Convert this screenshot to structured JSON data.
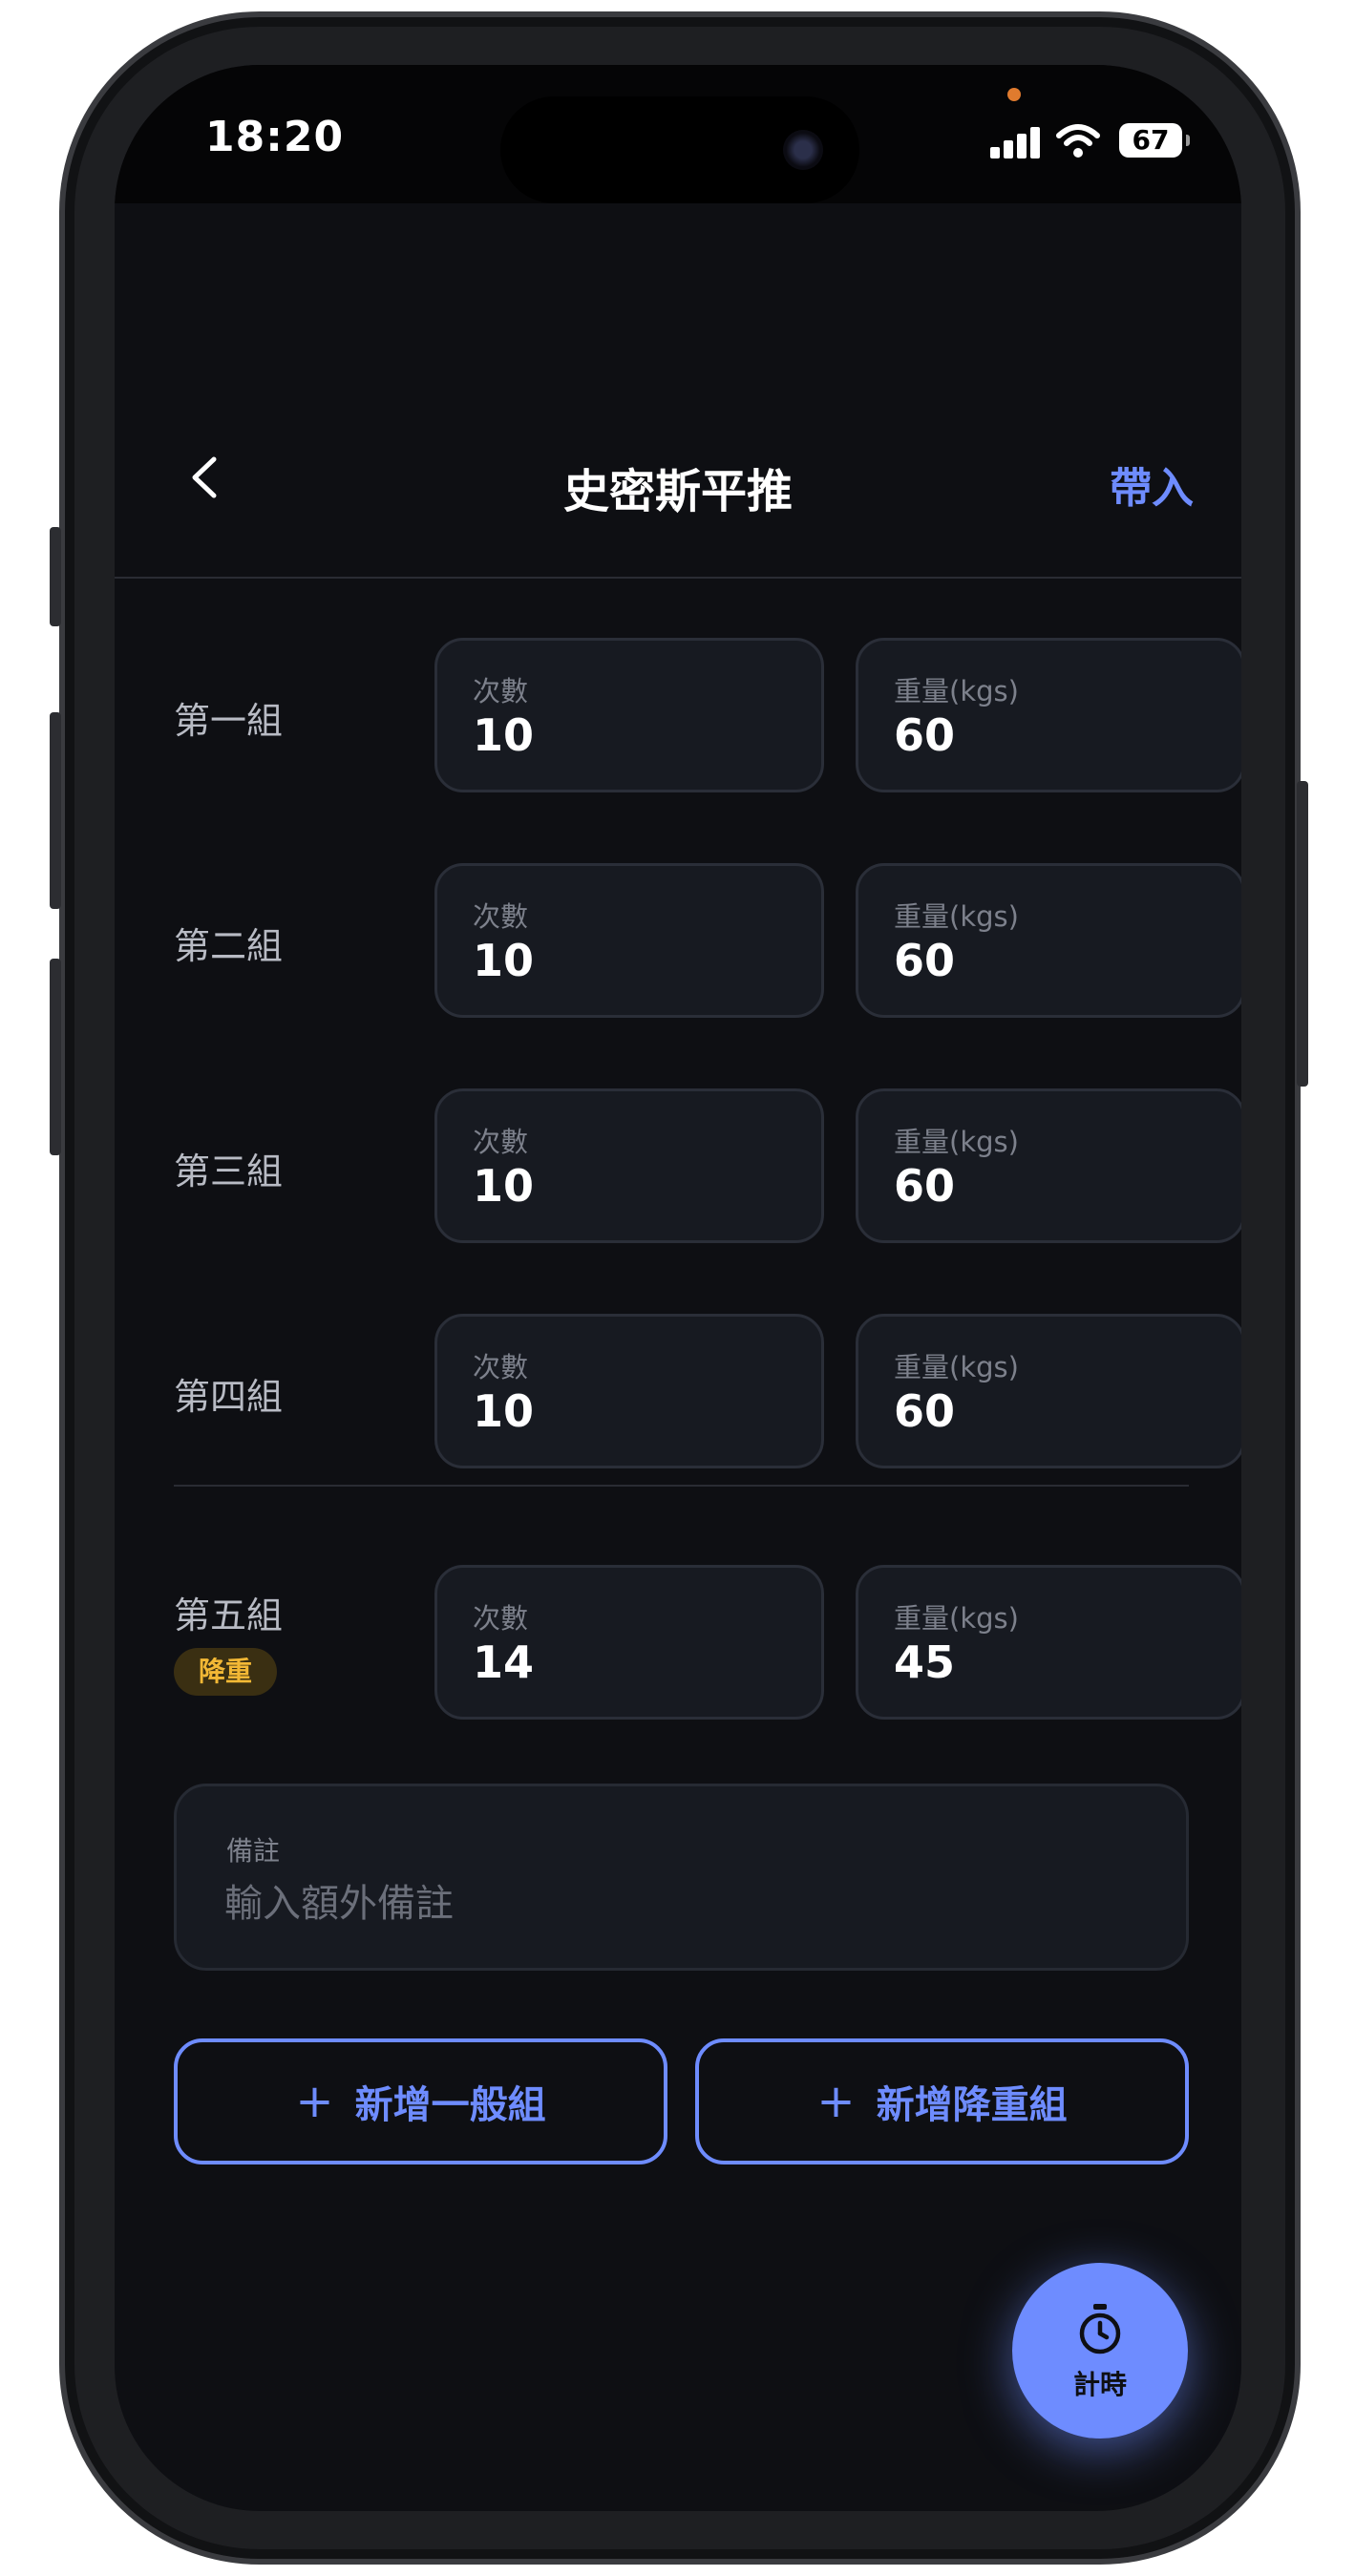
{
  "status_bar": {
    "time": "18:20",
    "battery": "67"
  },
  "header": {
    "title": "史密斯平推",
    "action_label": "帶入"
  },
  "sets": [
    {
      "label": "第一組",
      "reps_label": "次數",
      "reps": "10",
      "weight_label": "重量(kgs)",
      "weight": "60"
    },
    {
      "label": "第二組",
      "reps_label": "次數",
      "reps": "10",
      "weight_label": "重量(kgs)",
      "weight": "60"
    },
    {
      "label": "第三組",
      "reps_label": "次數",
      "reps": "10",
      "weight_label": "重量(kgs)",
      "weight": "60"
    },
    {
      "label": "第四組",
      "reps_label": "次數",
      "reps": "10",
      "weight_label": "重量(kgs)",
      "weight": "60"
    },
    {
      "label": "第五組",
      "badge": "降重",
      "reps_label": "次數",
      "reps": "14",
      "weight_label": "重量(kgs)",
      "weight": "45"
    }
  ],
  "notes": {
    "label": "備註",
    "placeholder": "輸入額外備註"
  },
  "buttons": {
    "add_normal": "新增一般組",
    "add_drop": "新增降重組",
    "plus": "+"
  },
  "timer": {
    "label": "計時"
  },
  "colors": {
    "accent": "#6e8cff",
    "background": "#0e0f13",
    "badge_text": "#f2b835",
    "badge_bg": "#3a2f12"
  }
}
